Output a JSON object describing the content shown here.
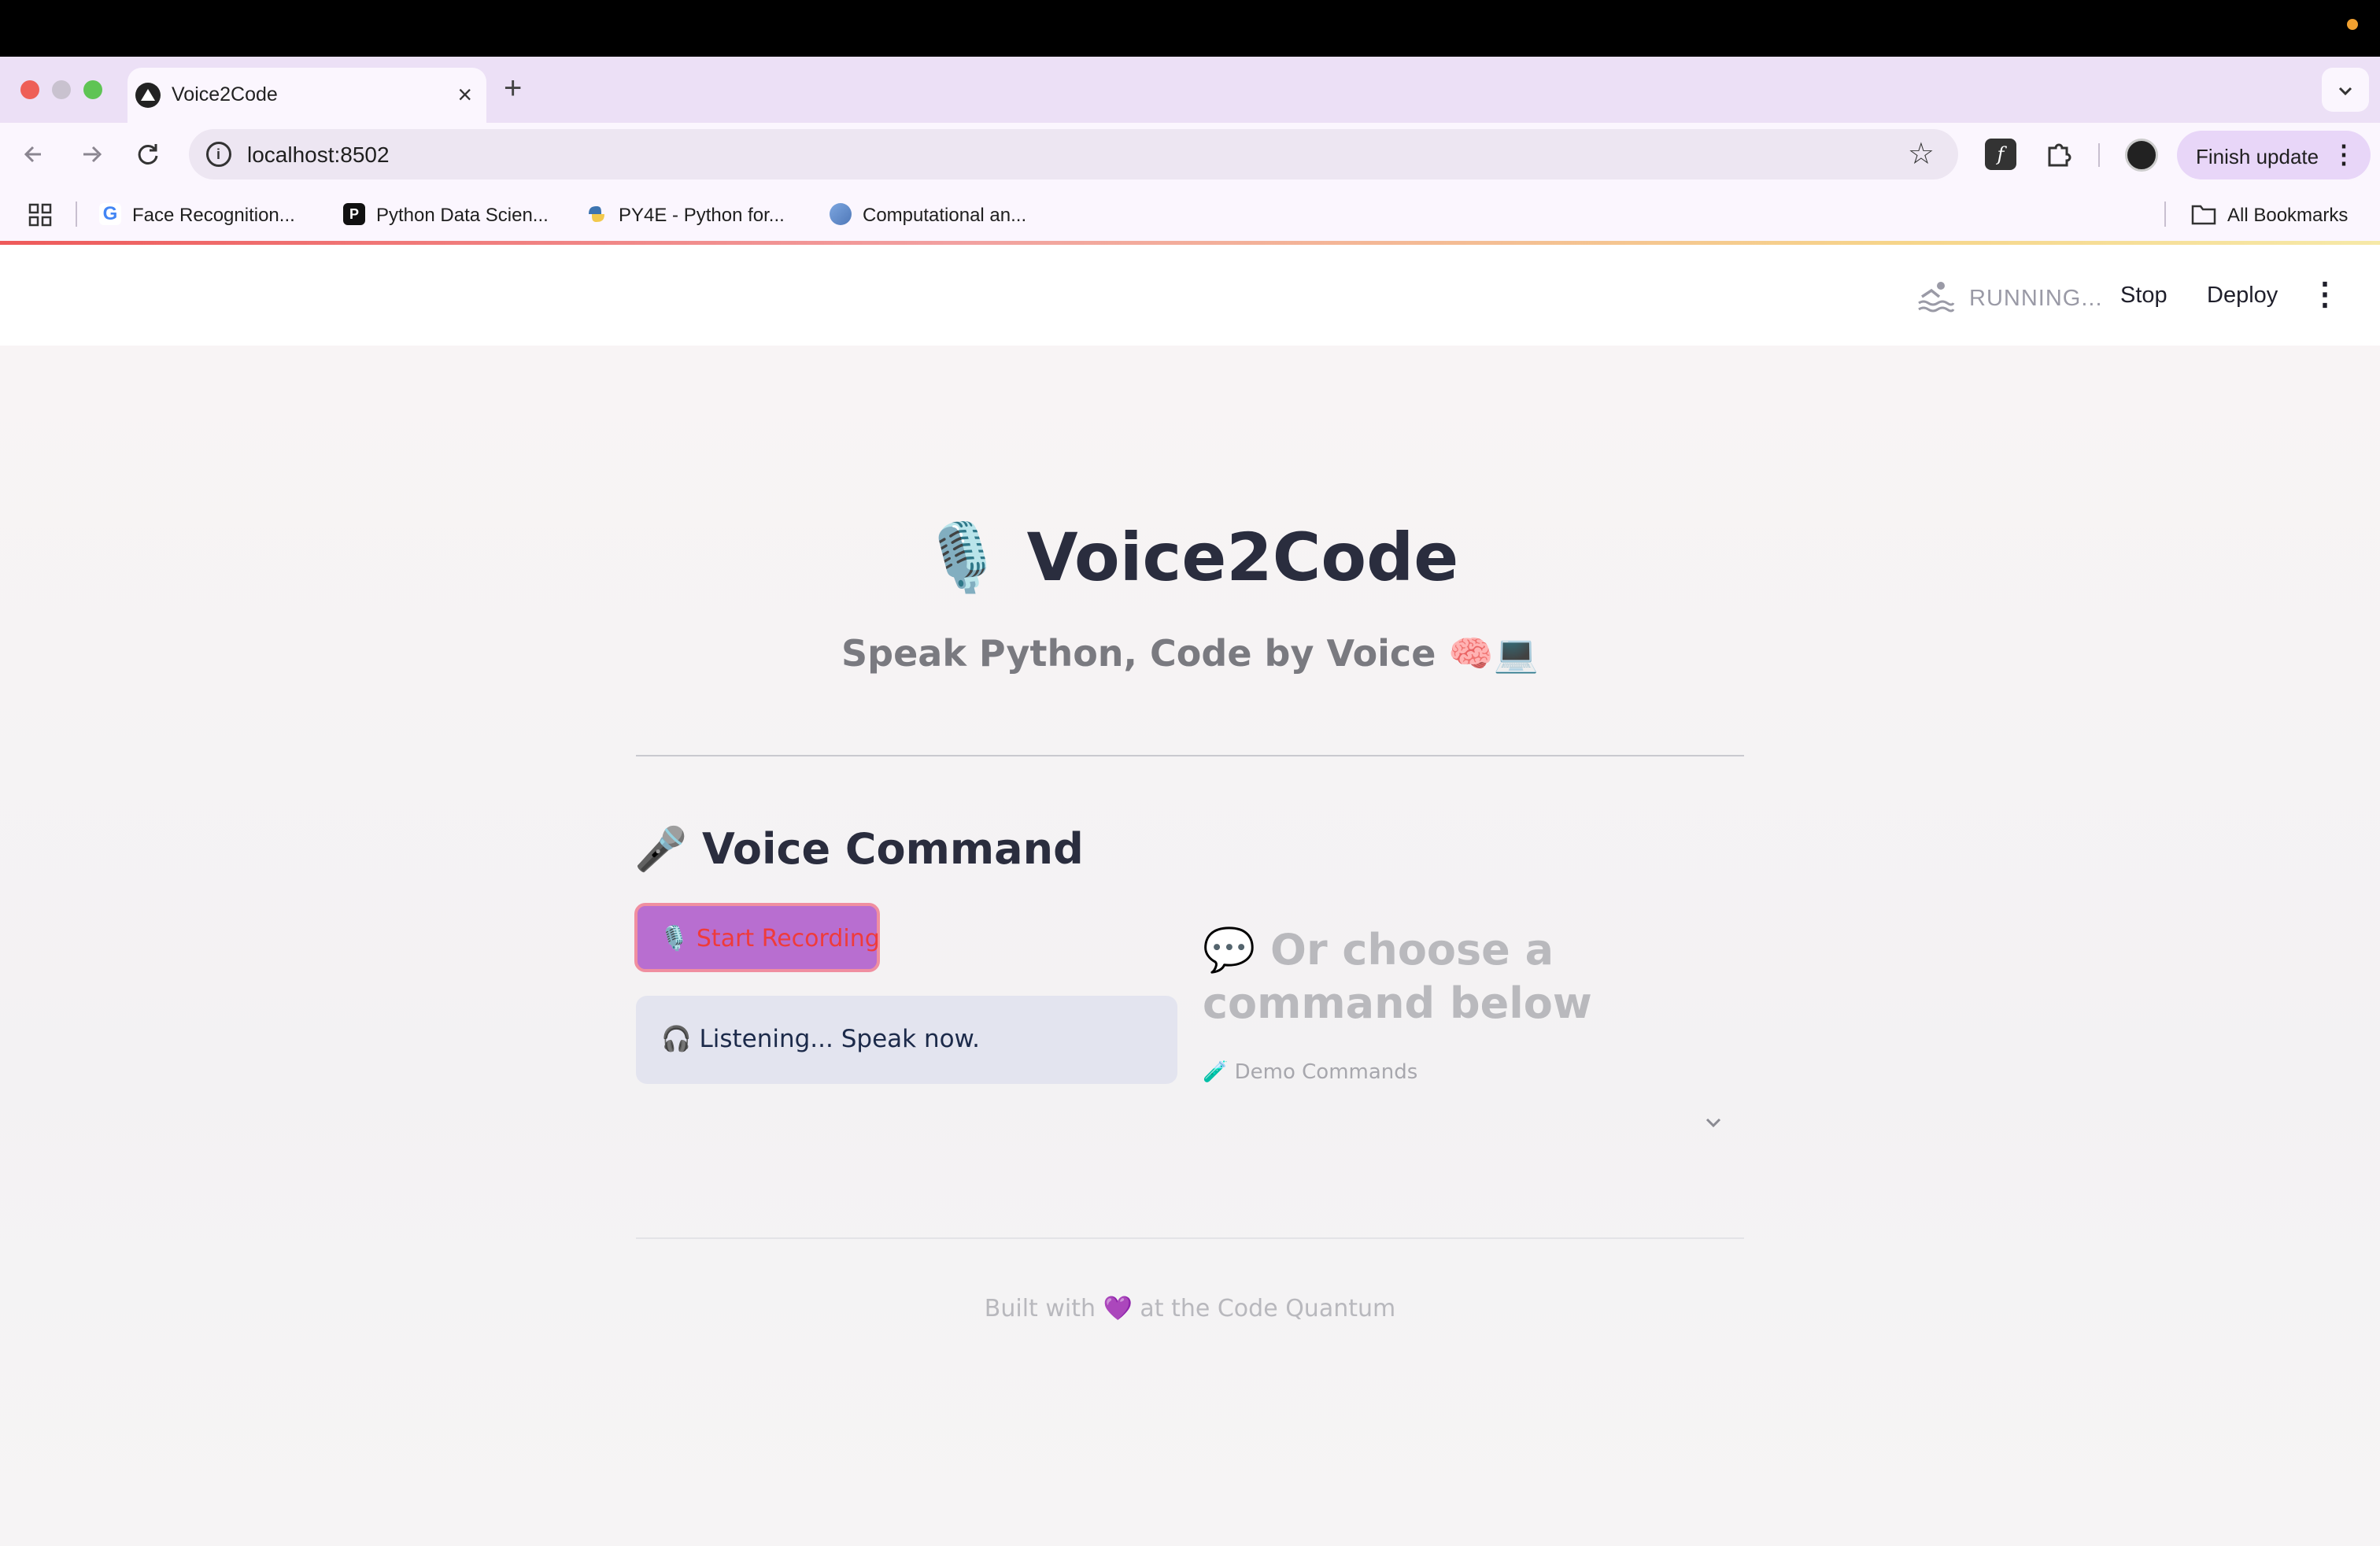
{
  "browser": {
    "tab_title": "Voice2Code",
    "new_tab_symbol": "+",
    "close_symbol": "×",
    "url": "localhost:8502",
    "finish_update_label": "Finish update",
    "bookmarks": [
      {
        "label": "Face Recognition...",
        "icon": "google-icon"
      },
      {
        "label": "Python Data Scien...",
        "icon": "p-icon"
      },
      {
        "label": "PY4E - Python for...",
        "icon": "python-icon"
      },
      {
        "label": "Computational an...",
        "icon": "globe-icon"
      }
    ],
    "all_bookmarks_label": "All Bookmarks"
  },
  "app_header": {
    "status_text": "RUNNING...",
    "stop_label": "Stop",
    "deploy_label": "Deploy"
  },
  "hero": {
    "title": "🎙️ Voice2Code",
    "subtitle": "Speak Python, Code by Voice 🧠💻"
  },
  "voice_section": {
    "title": "🎤 Voice Command",
    "record_button_label": "🎙️ Start Recording",
    "status_message": "🎧 Listening... Speak now."
  },
  "commands_section": {
    "title": "💬 Or choose a command below",
    "demo_label": "🧪 Demo Commands"
  },
  "footer": {
    "text": "Built with 💜 at the Code Quantum"
  },
  "colors": {
    "record_button_bg": "#b86ed0",
    "record_button_text": "#ef3b3b",
    "info_box_bg": "#e3e4ef",
    "tab_bar_bg": "#ece0f6"
  }
}
